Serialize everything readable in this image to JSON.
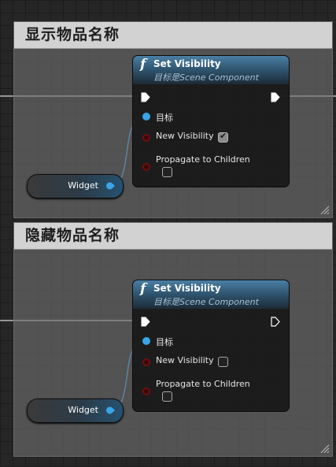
{
  "colors": {
    "target_pin": "#3aa5e6",
    "bool_pin": "#6e0f0f",
    "node_header": "#3a6a8c",
    "comment_header": "#d2d2d2"
  },
  "comments": [
    {
      "title": "显示物品名称",
      "node": {
        "icon": "function-icon",
        "fn_symbol": "f",
        "title": "Set Visibility",
        "subtitle": "目标是Scene Component",
        "pins": {
          "target": "目标",
          "new_visibility": "New Visibility",
          "propagate": "Propagate to Children"
        },
        "new_visibility_checked": true,
        "propagate_checked": false,
        "exec_out_connected": true
      },
      "variable": {
        "label": "Widget"
      }
    },
    {
      "title": "隐藏物品名称",
      "node": {
        "icon": "function-icon",
        "fn_symbol": "f",
        "title": "Set Visibility",
        "subtitle": "目标是Scene Component",
        "pins": {
          "target": "目标",
          "new_visibility": "New Visibility",
          "propagate": "Propagate to Children"
        },
        "new_visibility_checked": false,
        "propagate_checked": false,
        "exec_out_connected": false
      },
      "variable": {
        "label": "Widget"
      }
    }
  ]
}
